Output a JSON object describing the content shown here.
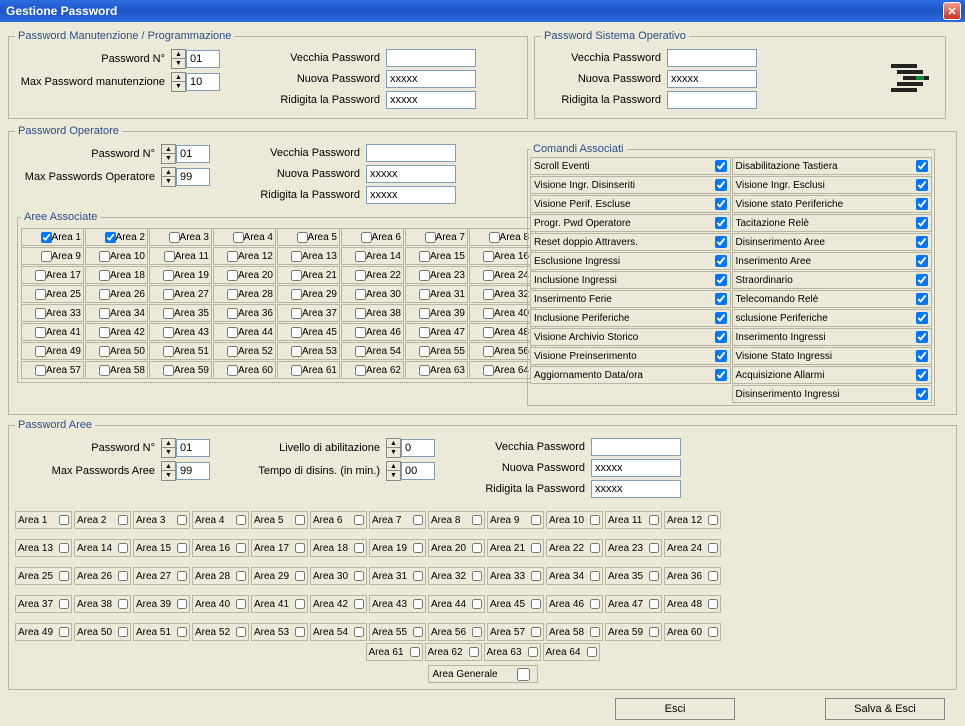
{
  "window": {
    "title": "Gestione Password"
  },
  "manut": {
    "legend": "Password Manutenzione / Programmazione",
    "pwnum_label": "Password  N°",
    "pwnum_value": "01",
    "max_label": "Max Password manutenzione",
    "max_value": "10",
    "vecchia_label": "Vecchia Password",
    "vecchia_value": "",
    "nuova_label": "Nuova Password",
    "nuova_value": "xxxxx",
    "ridigita_label": "Ridigita la Password",
    "ridigita_value": "xxxxx"
  },
  "sisop": {
    "legend": "Password Sistema Operativo",
    "vecchia_label": "Vecchia Password",
    "vecchia_value": "",
    "nuova_label": "Nuova Password",
    "nuova_value": "xxxxx",
    "ridigita_label": "Ridigita la Password",
    "ridigita_value": ""
  },
  "operatore": {
    "legend": "Password Operatore",
    "pwnum_label": "Password  N°",
    "pwnum_value": "01",
    "max_label": "Max Passwords Operatore",
    "max_value": "99",
    "vecchia_label": "Vecchia Password",
    "vecchia_value": "",
    "nuova_label": "Nuova Password",
    "nuova_value": "xxxxx",
    "ridigita_label": "Ridigita la Password",
    "ridigita_value": "xxxxx",
    "aree_associate_legend": "Aree Associate",
    "aree_checked": [
      1,
      2
    ],
    "comandi_legend": "Comandi Associati",
    "comandi_left": [
      "Scroll Eventi",
      "Visione Ingr. Disinseriti",
      "Visione Perif. Escluse",
      "Progr. Pwd Operatore",
      "Reset doppio Attravers.",
      "Esclusione Ingressi",
      "Inclusione Ingressi",
      "Inserimento Ferie",
      "Inclusione Periferiche",
      "Visione Archivio Storico",
      "Visione Preinserimento",
      "Aggiornamento Data/ora"
    ],
    "comandi_right": [
      "Disabilitazione Tastiera",
      "Visione Ingr. Esclusi",
      "Visione stato Periferiche",
      "Tacitazione Relè",
      "Disinserimento Aree",
      "Inserimento Aree",
      "Straordinario",
      "Telecomando Relè",
      "sclusione Periferiche",
      "Inserimento Ingressi",
      "Visione Stato Ingressi",
      "Acquisizione Allarmi",
      "Disinserimento Ingressi"
    ]
  },
  "aree": {
    "legend": "Password Aree",
    "pwnum_label": "Password  N°",
    "pwnum_value": "01",
    "max_label": "Max Passwords Aree",
    "max_value": "99",
    "livello_label": "Livello di abilitazione",
    "livello_value": "0",
    "tempo_label": "Tempo di disins. (in min.)",
    "tempo_value": "00",
    "vecchia_label": "Vecchia Password",
    "vecchia_value": "",
    "nuova_label": "Nuova Password",
    "nuova_value": "xxxxx",
    "ridigita_label": "Ridigita la Password",
    "ridigita_value": "xxxxx",
    "count": 64,
    "generale_label": "Area Generale"
  },
  "buttons": {
    "esci": "Esci",
    "salva": "Salva & Esci"
  }
}
